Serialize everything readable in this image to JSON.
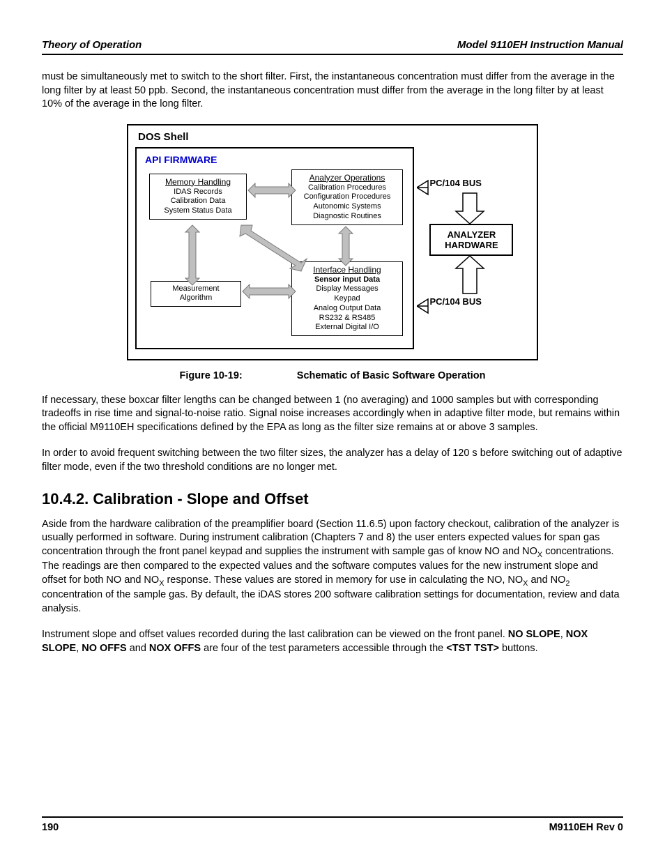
{
  "header": {
    "left": "Theory of Operation",
    "right": "Model 9110EH Instruction Manual"
  },
  "body": {
    "p1": "must be simultaneously met to switch to the short filter. First, the instantaneous concentration must differ from the average in the long filter by at least 50 ppb. Second, the instantaneous concentration must differ from the average in the long filter by at least 10% of the average in the long filter.",
    "p2": "If necessary, these boxcar filter lengths can be changed between 1 (no averaging) and 1000 samples but with corresponding tradeoffs in rise time and signal-to-noise ratio. Signal noise increases accordingly when in adaptive filter mode, but remains within the official M9110EH specifications defined by the EPA as long as the filter size remains at or above 3 samples.",
    "p3": "In order to avoid frequent switching between the two filter sizes, the analyzer has a delay of 120 s before switching out of adaptive filter mode, even if the two threshold conditions are no longer met.",
    "p4_pre": "Aside from the hardware calibration of the preamplifier board (Section 11.6.5) upon factory checkout, calibration of the analyzer is usually performed in software. During instrument calibration (Chapters 7 and 8) the user enters expected values for span gas concentration through the front panel keypad and supplies the instrument with sample gas of know NO and NO",
    "p4_mid1": " concentrations. The readings are then compared to the expected values and the software computes values for the new instrument slope and offset for both NO and NO",
    "p4_mid2": " response. These values are stored in memory for use in calculating the NO, NO",
    "p4_mid3": " and NO",
    "p4_end": " concentration of the sample gas. By default, the iDAS stores 200 software calibration settings for documentation, review and data analysis.",
    "p5_pre": "Instrument slope and offset values recorded during the last calibration can be viewed on the front panel. ",
    "p5_b1": "NO SLOPE",
    "p5_s1": ", ",
    "p5_b2": "NOX SLOPE",
    "p5_s2": ", ",
    "p5_b3": "NO OFFS",
    "p5_s3": " and ",
    "p5_b4": "NOX OFFS",
    "p5_s4": " are four of the test parameters accessible through the ",
    "p5_b5": "<TST TST>",
    "p5_s5": " buttons."
  },
  "section_heading": "10.4.2. Calibration - Slope and Offset",
  "figure": {
    "caption_num": "Figure 10-19:",
    "caption_text": "Schematic of Basic Software Operation",
    "dos_shell": "DOS Shell",
    "api_firmware": "API FIRMWARE",
    "memory": {
      "title": "Memory Handling",
      "l1": "IDAS Records",
      "l2": "Calibration Data",
      "l3": "System Status Data"
    },
    "analyzer_ops": {
      "title": "Analyzer Operations",
      "l1": "Calibration Procedures",
      "l2": "Configuration Procedures",
      "l3": "Autonomic Systems",
      "l4": "Diagnostic Routines"
    },
    "measurement": {
      "title": "Measurement",
      "l2": "Algorithm"
    },
    "interface": {
      "title": "Interface Handling",
      "b1": "Sensor input Data",
      "l1": "Display Messages",
      "l2": "Keypad",
      "l3": "Analog Output Data",
      "l4": "RS232 & RS485",
      "l5": "External Digital I/O"
    },
    "bus1": "PC/104 BUS",
    "analyzer_hw": "ANALYZER HARDWARE",
    "bus2": "PC/104 BUS"
  },
  "footer": {
    "page_num": "190",
    "rev": "M9110EH Rev 0"
  }
}
